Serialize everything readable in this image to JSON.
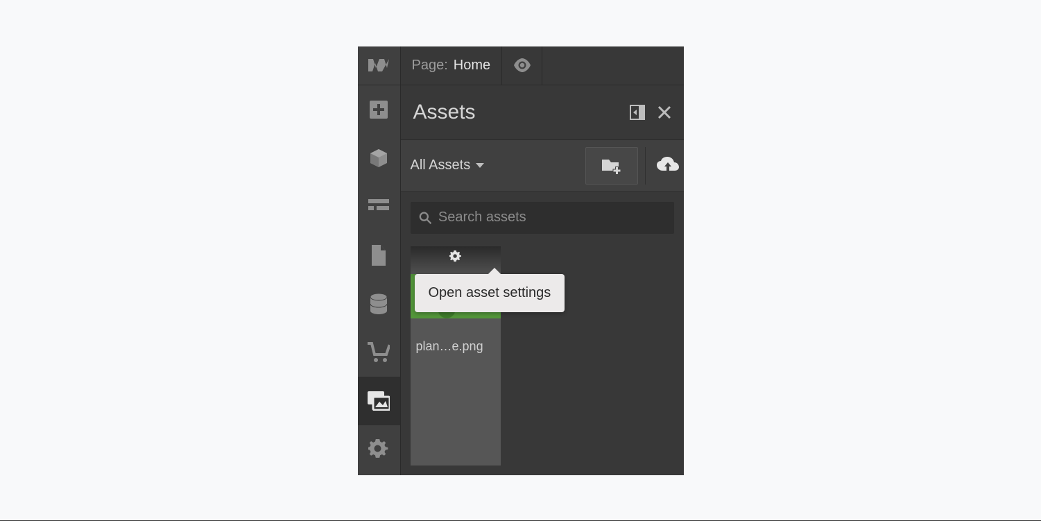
{
  "topbar": {
    "page_label": "Page:",
    "page_name": "Home"
  },
  "panel": {
    "title": "Assets",
    "filter_label": "All Assets",
    "search_placeholder": "Search assets"
  },
  "asset": {
    "filename": "plan…e.png"
  },
  "tooltip": {
    "text": "Open asset settings"
  },
  "icons": {
    "logo": "webflow-logo",
    "preview": "eye-icon",
    "rail": [
      "add-icon",
      "cube-icon",
      "navigator-icon",
      "page-icon",
      "cms-icon",
      "ecommerce-icon",
      "assets-icon",
      "settings-icon"
    ]
  },
  "colors": {
    "panel_bg": "#383838",
    "rail_bg": "#404040",
    "active_bg": "#2f2f2f",
    "text_muted": "#9c9c9c",
    "text": "#d6d6d6",
    "tooltip_bg": "#eceaea"
  }
}
